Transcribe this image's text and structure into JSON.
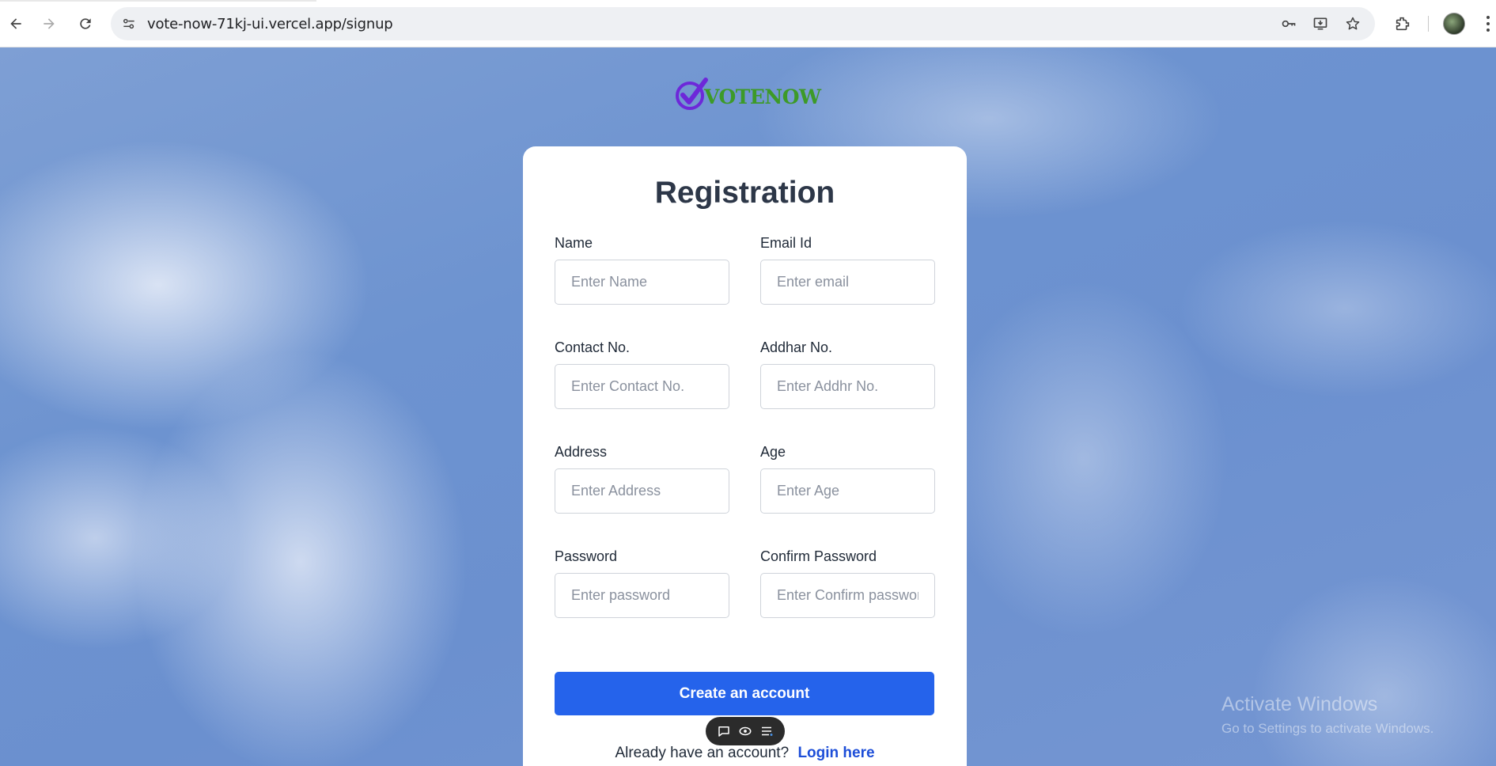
{
  "browser": {
    "url": "vote-now-71kj-ui.vercel.app/signup",
    "icons": [
      "back-icon",
      "forward-icon",
      "reload-icon",
      "site-settings-icon",
      "password-key-icon",
      "install-app-icon",
      "bookmark-star-icon",
      "extensions-icon",
      "profile-avatar",
      "more-menu-icon"
    ]
  },
  "logo": {
    "text": "VOTENOW"
  },
  "form": {
    "title": "Registration",
    "fields": [
      {
        "label": "Name",
        "placeholder": "Enter Name"
      },
      {
        "label": "Email Id",
        "placeholder": "Enter email"
      },
      {
        "label": "Contact No.",
        "placeholder": "Enter Contact No."
      },
      {
        "label": "Addhar No.",
        "placeholder": "Enter Addhr No."
      },
      {
        "label": "Address",
        "placeholder": "Enter Address"
      },
      {
        "label": "Age",
        "placeholder": "Enter Age"
      },
      {
        "label": "Password",
        "placeholder": "Enter password"
      },
      {
        "label": "Confirm Password",
        "placeholder": "Enter Confirm password"
      }
    ],
    "submit_label": "Create an account",
    "login_prompt": "Already have an account?",
    "login_link": "Login here"
  },
  "watermark": {
    "line1": "Activate Windows",
    "line2": "Go to Settings to activate Windows."
  },
  "colors": {
    "primary_button": "#2563eb",
    "login_link": "#1d4ed8",
    "logo_check": "#6d28d9",
    "logo_text": "#3d9a28"
  }
}
